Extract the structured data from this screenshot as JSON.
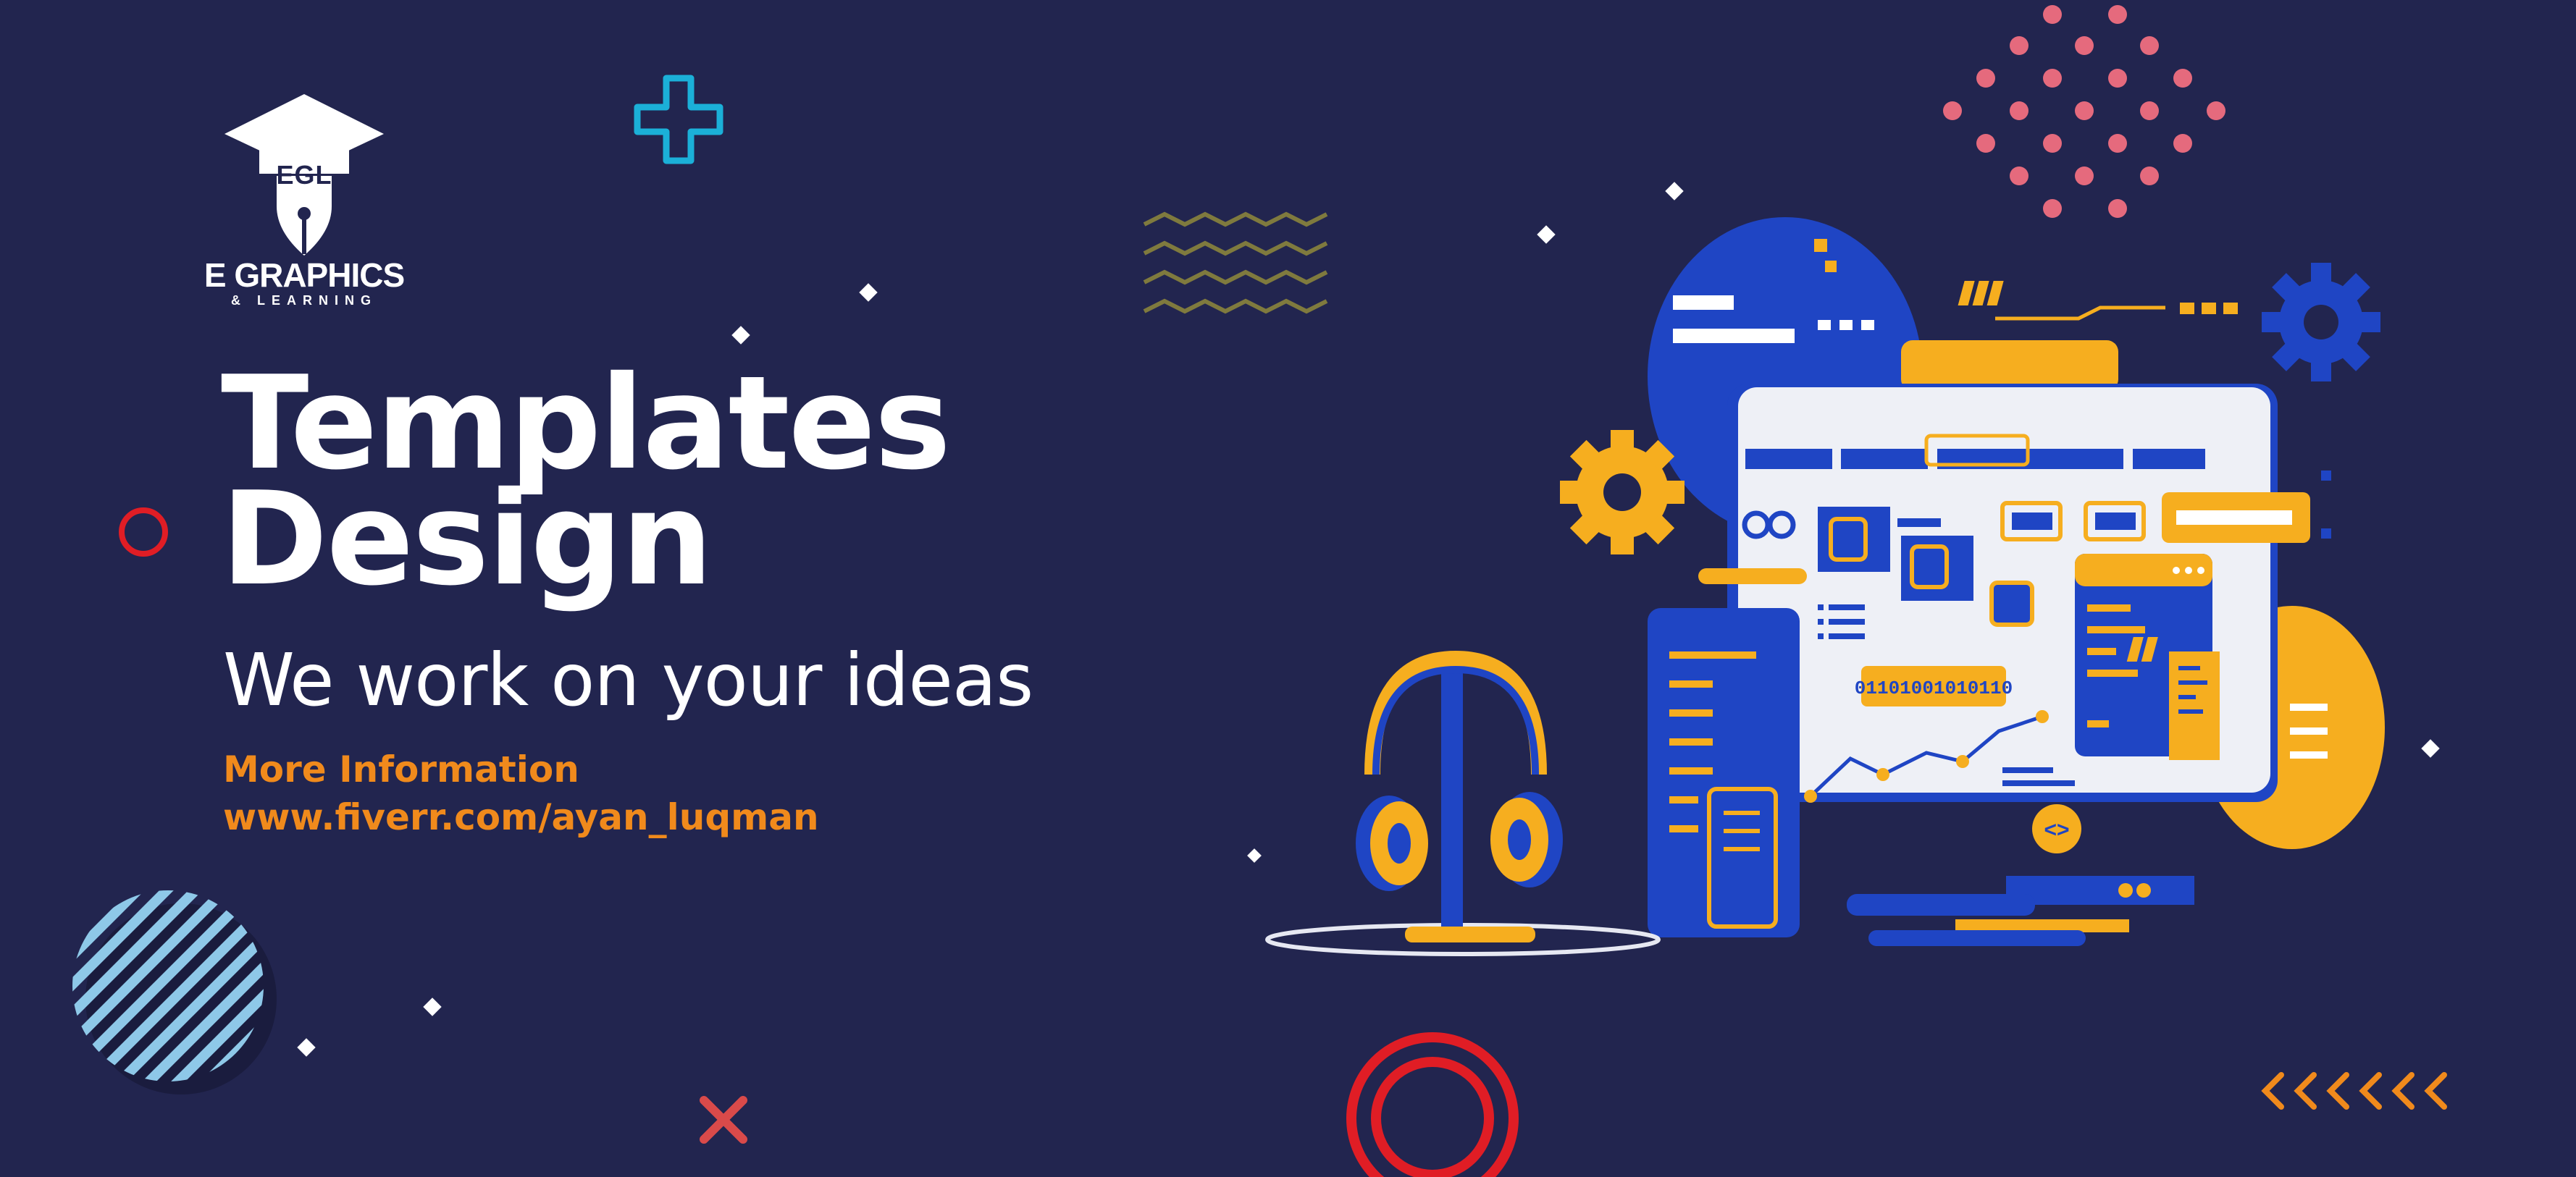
{
  "brand": {
    "name": "E GRAPHICS",
    "tagline": "& LEARNING",
    "monogram": "EGL"
  },
  "hero": {
    "title_line1": "Templates",
    "title_line2": "Design",
    "subtitle": "We work on your ideas"
  },
  "contact": {
    "label": "More Information",
    "url": "www.fiverr.com/ayan_luqman"
  },
  "illustration": {
    "binary_text": "01101001010110",
    "code_symbol": "<>"
  },
  "colors": {
    "background": "#22254f",
    "accent_orange": "#f08a1c",
    "accent_yellow": "#f6ae1f",
    "accent_blue": "#1f45c4",
    "accent_red": "#e01d25",
    "accent_pink": "#e56a7d",
    "accent_cyan": "#1bb0d8"
  }
}
